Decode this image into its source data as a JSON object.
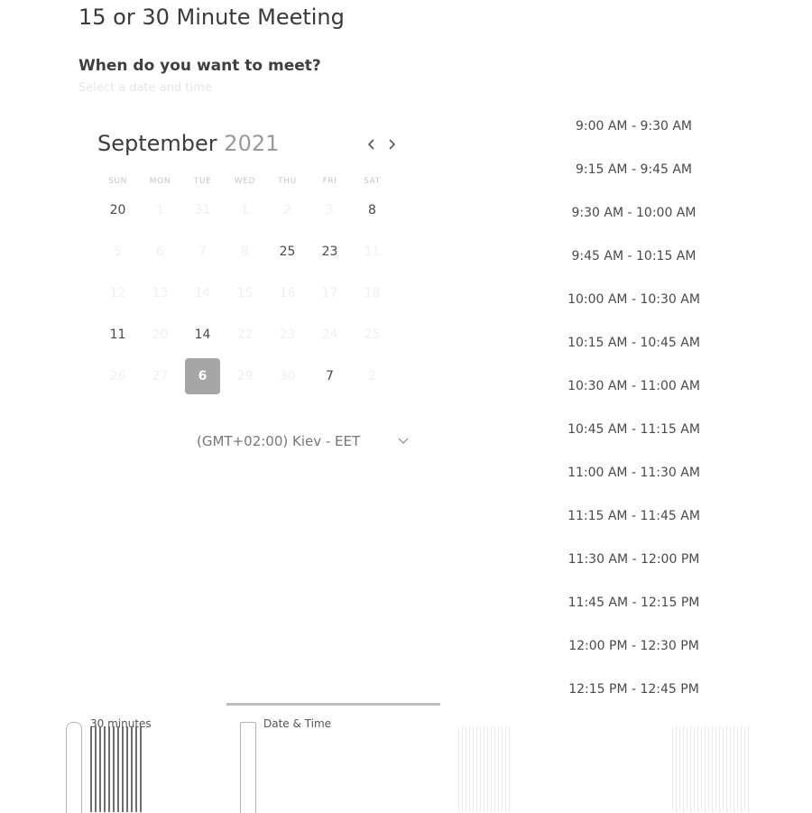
{
  "page": {
    "title": "15 or 30 Minute Meeting",
    "subtitle": "When do you want to meet?",
    "hint": "Select a date and time"
  },
  "calendar": {
    "month": "September",
    "year": "2021",
    "weekdays": [
      "SUN",
      "MON",
      "TUE",
      "WED",
      "THU",
      "FRI",
      "SAT"
    ],
    "selected_day": "6",
    "weeks": [
      [
        "20",
        "1",
        "31",
        "1",
        "2",
        "3",
        "8"
      ],
      [
        "5",
        "6",
        "7",
        "8",
        "25",
        "23",
        "11"
      ],
      [
        "12",
        "13",
        "14",
        "15",
        "16",
        "17",
        "18"
      ],
      [
        "11",
        "20",
        "14",
        "22",
        "23",
        "24",
        "25"
      ],
      [
        "26",
        "27",
        "6",
        "29",
        "30",
        "7",
        "2"
      ]
    ],
    "faint": [
      [
        false,
        true,
        true,
        true,
        true,
        true,
        false
      ],
      [
        true,
        true,
        true,
        true,
        false,
        false,
        true
      ],
      [
        true,
        true,
        true,
        true,
        true,
        true,
        true
      ],
      [
        false,
        true,
        false,
        true,
        true,
        true,
        true
      ],
      [
        true,
        true,
        false,
        true,
        true,
        false,
        true
      ]
    ]
  },
  "timezone": {
    "label": "(GMT+02:00) Kiev - EET"
  },
  "slots": [
    "9:00 AM - 9:30 AM",
    "9:15 AM - 9:45 AM",
    "9:30 AM - 10:00 AM",
    "9:45 AM - 10:15 AM",
    "10:00 AM - 10:30 AM",
    "10:15 AM - 10:45 AM",
    "10:30 AM - 11:00 AM",
    "10:45 AM - 11:15 AM",
    "11:00 AM - 11:30 AM",
    "11:15 AM - 11:45 AM",
    "11:30 AM - 12:00 PM",
    "11:45 AM - 12:15 PM",
    "12:00 PM - 12:30 PM",
    "12:15 PM - 12:45 PM"
  ],
  "steps": [
    {
      "label": "30 minutes",
      "icon": "clock-icon"
    },
    {
      "label": "Date & Time",
      "icon": "calendar-icon"
    }
  ],
  "colors": {
    "selected_day_bg": "#a6a6a6",
    "text": "#4a4a4a",
    "muted": "#9a9a9a"
  }
}
